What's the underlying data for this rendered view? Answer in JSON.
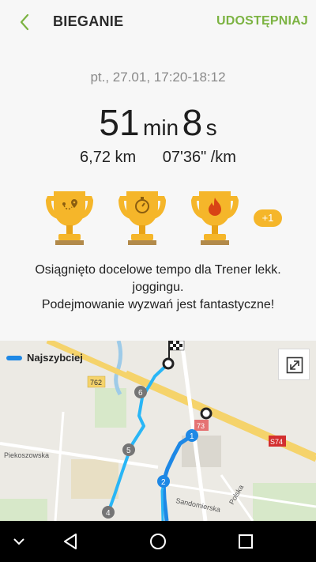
{
  "header": {
    "title": "BIEGANIE",
    "share_label": "UDOSTĘPNIAJ"
  },
  "summary": {
    "datetime": "pt., 27.01, 17:20-18:12",
    "minutes": "51",
    "minutes_unit": "min",
    "seconds": "8",
    "seconds_unit": "s",
    "distance": "6,72 km",
    "pace": "07'36\" /km"
  },
  "achievements": {
    "items": [
      "route-trophy",
      "stopwatch-trophy",
      "flame-trophy"
    ],
    "extra_count": "+1"
  },
  "message": {
    "line1": "Osiągnięto docelowe tempo dla Trener lekk. joggingu.",
    "line2": "Podejmowanie wyzwań jest fantastyczne!"
  },
  "map": {
    "legend_label": "Najszybciej",
    "legend_color": "#1e88e5",
    "street_labels": [
      "Piekoszowska",
      "Sandomierska",
      "Polska"
    ],
    "road_badges": [
      "762",
      "73",
      "S74"
    ],
    "route_markers": [
      "1",
      "2",
      "4",
      "5",
      "6"
    ],
    "colors": {
      "route_fast": "#1e88e5",
      "route_normal": "#29b6f6",
      "marker_gray": "#757575"
    }
  },
  "colors": {
    "accent": "#7cb342",
    "trophy_gold": "#f5b62a"
  }
}
